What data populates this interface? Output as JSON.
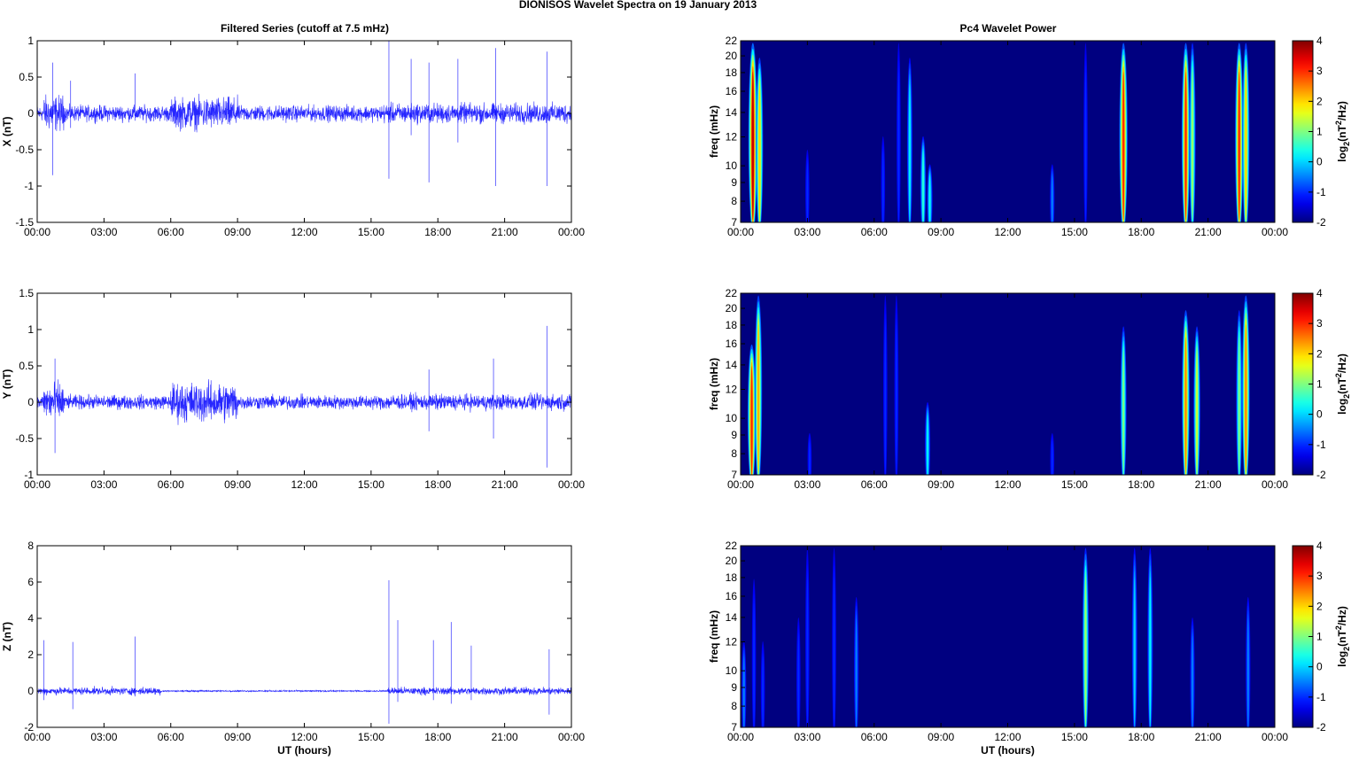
{
  "chart_data": {
    "title": "DIONISOS Wavelet Spectra on 19 January   2013",
    "time_ticks": [
      "00:00",
      "03:00",
      "06:00",
      "09:00",
      "12:00",
      "15:00",
      "18:00",
      "21:00",
      "00:00"
    ],
    "x_range_hours": [
      0,
      24
    ],
    "xlabel": "UT (hours)",
    "series_panels": {
      "type": "line",
      "title": "Filtered Series (cutoff at 7.5 mHz)",
      "color": "#0000ff",
      "panels": [
        {
          "ylabel": "X (nT)",
          "ylim": [
            -1.5,
            1
          ],
          "yticks": [
            "-1.5",
            "-1",
            "-0.5",
            "0",
            "0.5",
            "1"
          ],
          "ytick_values": [
            -1.5,
            -1,
            -0.5,
            0,
            0.5,
            1
          ],
          "noise_amplitude": 0.08,
          "bursts": [
            {
              "from": 0.3,
              "to": 1.2,
              "amp": 0.18
            },
            {
              "from": 6,
              "to": 9,
              "amp": 0.16
            },
            {
              "from": 15.5,
              "to": 24,
              "amp": 0.1
            }
          ],
          "spikes": [
            {
              "t": 0.7,
              "max": 0.7,
              "min": -0.85
            },
            {
              "t": 1.5,
              "max": 0.45,
              "min": -0.2
            },
            {
              "t": 4.4,
              "max": 0.55,
              "min": -0.1
            },
            {
              "t": 15.8,
              "max": 1.0,
              "min": -0.9
            },
            {
              "t": 16.8,
              "max": 0.75,
              "min": -0.3
            },
            {
              "t": 17.6,
              "max": 0.7,
              "min": -0.95
            },
            {
              "t": 18.9,
              "max": 0.75,
              "min": -0.4
            },
            {
              "t": 20.6,
              "max": 0.9,
              "min": -1.0
            },
            {
              "t": 22.9,
              "max": 0.85,
              "min": -1.0
            }
          ]
        },
        {
          "ylabel": "Y (nT)",
          "ylim": [
            -1,
            1.5
          ],
          "yticks": [
            "-1",
            "-0.5",
            "0",
            "0.5",
            "1",
            "1.5"
          ],
          "ytick_values": [
            -1,
            -0.5,
            0,
            0.5,
            1,
            1.5
          ],
          "noise_amplitude": 0.07,
          "bursts": [
            {
              "from": 0.3,
              "to": 1.2,
              "amp": 0.2
            },
            {
              "from": 6,
              "to": 9,
              "amp": 0.2
            },
            {
              "from": 15.5,
              "to": 24,
              "amp": 0.08
            }
          ],
          "spikes": [
            {
              "t": 0.8,
              "max": 0.6,
              "min": -0.7
            },
            {
              "t": 17.6,
              "max": 0.45,
              "min": -0.4
            },
            {
              "t": 20.5,
              "max": 0.6,
              "min": -0.5
            },
            {
              "t": 22.9,
              "max": 1.05,
              "min": -0.9
            }
          ]
        },
        {
          "ylabel": "Z (nT)",
          "ylim": [
            -2,
            8
          ],
          "yticks": [
            "-2",
            "0",
            "2",
            "4",
            "6",
            "8"
          ],
          "ytick_values": [
            -2,
            0,
            2,
            4,
            6,
            8
          ],
          "noise_amplitude": 0.15,
          "bursts": [
            {
              "from": 5.6,
              "to": 15.7,
              "amp": 0.03
            }
          ],
          "spikes": [
            {
              "t": 0.3,
              "max": 2.8,
              "min": -0.5
            },
            {
              "t": 1.6,
              "max": 2.7,
              "min": -1.0
            },
            {
              "t": 4.4,
              "max": 3.0,
              "min": -0.3
            },
            {
              "t": 15.8,
              "max": 6.1,
              "min": -1.8
            },
            {
              "t": 16.2,
              "max": 3.9,
              "min": -0.6
            },
            {
              "t": 17.8,
              "max": 2.8,
              "min": -0.5
            },
            {
              "t": 18.6,
              "max": 3.8,
              "min": -0.7
            },
            {
              "t": 19.5,
              "max": 2.5,
              "min": -0.5
            },
            {
              "t": 23.0,
              "max": 2.3,
              "min": -1.3
            }
          ]
        }
      ]
    },
    "spectra_panels": {
      "type": "heatmap",
      "title": "Pc4 Wavelet Power",
      "ylabel": "freq (mHz)",
      "yscale": "log",
      "ylim": [
        7,
        22
      ],
      "yticks": [
        7,
        8,
        9,
        10,
        12,
        14,
        16,
        18,
        20,
        22
      ],
      "colorbar": {
        "label_base": "log",
        "label_sub": "2",
        "label_mid": "(nT",
        "label_sup": "2",
        "label_end": "/Hz)",
        "range": [
          -2,
          4
        ],
        "ticks": [
          "-2",
          "-1",
          "0",
          "1",
          "2",
          "3",
          "4"
        ],
        "tick_values": [
          -2,
          -1,
          0,
          1,
          2,
          3,
          4
        ],
        "colormap": "jet"
      },
      "panels": [
        {
          "events": [
            {
              "t": 0.55,
              "peak": 3.6,
              "fhi": 22
            },
            {
              "t": 0.85,
              "peak": 2.0,
              "fhi": 20
            },
            {
              "t": 3.0,
              "peak": -1,
              "fhi": 11
            },
            {
              "t": 6.4,
              "peak": -1,
              "fhi": 12
            },
            {
              "t": 7.1,
              "peak": -1,
              "fhi": 22
            },
            {
              "t": 7.6,
              "peak": 0.2,
              "fhi": 20
            },
            {
              "t": 8.2,
              "peak": 0.5,
              "fhi": 12
            },
            {
              "t": 8.5,
              "peak": 0.3,
              "fhi": 10
            },
            {
              "t": 14.0,
              "peak": -0.5,
              "fhi": 10
            },
            {
              "t": 15.5,
              "peak": -1,
              "fhi": 22
            },
            {
              "t": 17.2,
              "peak": 3.0,
              "fhi": 22
            },
            {
              "t": 20.0,
              "peak": 3.0,
              "fhi": 22
            },
            {
              "t": 20.3,
              "peak": 1.2,
              "fhi": 22
            },
            {
              "t": 22.4,
              "peak": 3.0,
              "fhi": 22
            },
            {
              "t": 22.7,
              "peak": 2.0,
              "fhi": 22
            }
          ]
        },
        {
          "events": [
            {
              "t": 0.5,
              "peak": 3.0,
              "fhi": 16
            },
            {
              "t": 0.8,
              "peak": 2.2,
              "fhi": 22
            },
            {
              "t": 3.1,
              "peak": -1,
              "fhi": 9
            },
            {
              "t": 6.5,
              "peak": -1,
              "fhi": 22
            },
            {
              "t": 7.0,
              "peak": -1,
              "fhi": 22
            },
            {
              "t": 8.4,
              "peak": 0.2,
              "fhi": 11
            },
            {
              "t": 14.0,
              "peak": -1,
              "fhi": 9
            },
            {
              "t": 17.2,
              "peak": 1.0,
              "fhi": 18
            },
            {
              "t": 20.0,
              "peak": 2.5,
              "fhi": 20
            },
            {
              "t": 20.5,
              "peak": 1.5,
              "fhi": 18
            },
            {
              "t": 22.4,
              "peak": 1.0,
              "fhi": 20
            },
            {
              "t": 22.7,
              "peak": 2.5,
              "fhi": 22
            }
          ]
        },
        {
          "events": [
            {
              "t": 0.15,
              "peak": -0.5,
              "fhi": 12
            },
            {
              "t": 0.6,
              "peak": -1,
              "fhi": 18
            },
            {
              "t": 1.0,
              "peak": -1,
              "fhi": 12
            },
            {
              "t": 2.6,
              "peak": -1,
              "fhi": 14
            },
            {
              "t": 3.0,
              "peak": -1,
              "fhi": 22
            },
            {
              "t": 4.2,
              "peak": -1,
              "fhi": 22
            },
            {
              "t": 5.2,
              "peak": -0.5,
              "fhi": 16
            },
            {
              "t": 15.5,
              "peak": 1.2,
              "fhi": 22
            },
            {
              "t": 17.7,
              "peak": 0.0,
              "fhi": 22
            },
            {
              "t": 18.4,
              "peak": 0.2,
              "fhi": 22
            },
            {
              "t": 20.3,
              "peak": -0.5,
              "fhi": 14
            },
            {
              "t": 22.8,
              "peak": -0.5,
              "fhi": 16
            }
          ]
        }
      ]
    }
  }
}
